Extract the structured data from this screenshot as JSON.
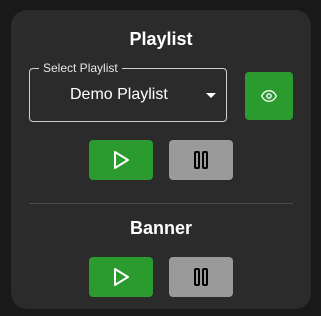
{
  "playlist": {
    "title": "Playlist",
    "select_label": "Select Playlist",
    "selected_value": "Demo Playlist"
  },
  "banner": {
    "title": "Banner"
  },
  "icons": {
    "preview": "eye-icon",
    "play": "play-icon",
    "pause": "pause-icon",
    "dropdown": "caret-down-icon"
  },
  "colors": {
    "panel_bg": "#2b2b2b",
    "page_bg": "#191919",
    "green": "#2b9a2f",
    "grey": "#9a9a9a",
    "text": "#ffffff"
  }
}
